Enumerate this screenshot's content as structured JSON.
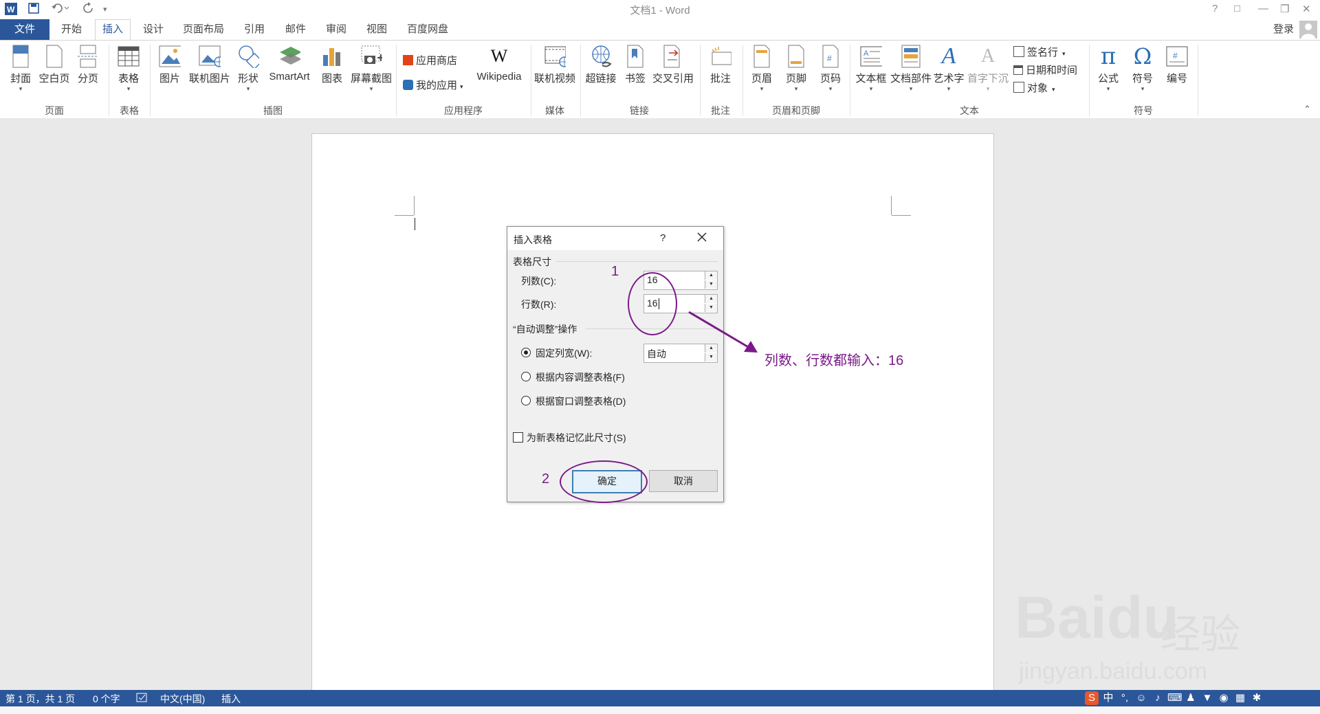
{
  "title_bar": {
    "title": "文档1 - Word",
    "help": "?",
    "buttons": [
      "□",
      "—",
      "❐",
      "✕"
    ]
  },
  "tabs": {
    "file": "文件",
    "items": [
      "开始",
      "插入",
      "设计",
      "页面布局",
      "引用",
      "邮件",
      "审阅",
      "视图",
      "百度网盘"
    ],
    "active": "插入",
    "login": "登录"
  },
  "ribbon": {
    "groups": {
      "pages": {
        "label": "页面",
        "buttons": [
          "封面",
          "空白页",
          "分页"
        ]
      },
      "tables": {
        "label": "表格",
        "buttons": [
          "表格"
        ]
      },
      "illustrations": {
        "label": "插图",
        "buttons": [
          "图片",
          "联机图片",
          "形状",
          "SmartArt",
          "图表",
          "屏幕截图"
        ]
      },
      "apps": {
        "label": "应用程序",
        "store": "应用商店",
        "my_apps": "我的应用",
        "wikipedia": "Wikipedia"
      },
      "media": {
        "label": "媒体",
        "buttons": [
          "联机视频"
        ]
      },
      "links": {
        "label": "链接",
        "buttons": [
          "超链接",
          "书签",
          "交叉引用"
        ]
      },
      "comments": {
        "label": "批注",
        "buttons": [
          "批注"
        ]
      },
      "header_footer": {
        "label": "页眉和页脚",
        "buttons": [
          "页眉",
          "页脚",
          "页码"
        ]
      },
      "text": {
        "label": "文本",
        "buttons": [
          "文本框",
          "文档部件",
          "艺术字",
          "首字下沉"
        ],
        "signature": "签名行",
        "datetime": "日期和时间",
        "object": "对象"
      },
      "symbols": {
        "label": "符号",
        "buttons": [
          "公式",
          "符号",
          "编号"
        ]
      }
    }
  },
  "dialog": {
    "title": "插入表格",
    "help": "?",
    "section_size": "表格尺寸",
    "columns_label": "列数(C):",
    "columns_value": "16",
    "rows_label": "行数(R):",
    "rows_value": "16",
    "section_autofit": "“自动调整”操作",
    "fixed_width_label": "固定列宽(W):",
    "fixed_width_value": "自动",
    "autofit_contents": "根据内容调整表格(F)",
    "autofit_window": "根据窗口调整表格(D)",
    "remember": "为新表格记忆此尺寸(S)",
    "ok": "确定",
    "cancel": "取消"
  },
  "annotations": {
    "step1": "1",
    "step2": "2",
    "note": "列数、行数都输入：16"
  },
  "status_bar": {
    "page": "第 1 页，共 1 页",
    "words": "0 个字",
    "language": "中文(中国)",
    "mode": "插入",
    "ime_mode": "中"
  },
  "watermark": {
    "brand": "Baidu",
    "cn": "经验",
    "url": "jingyan.baidu.com"
  }
}
